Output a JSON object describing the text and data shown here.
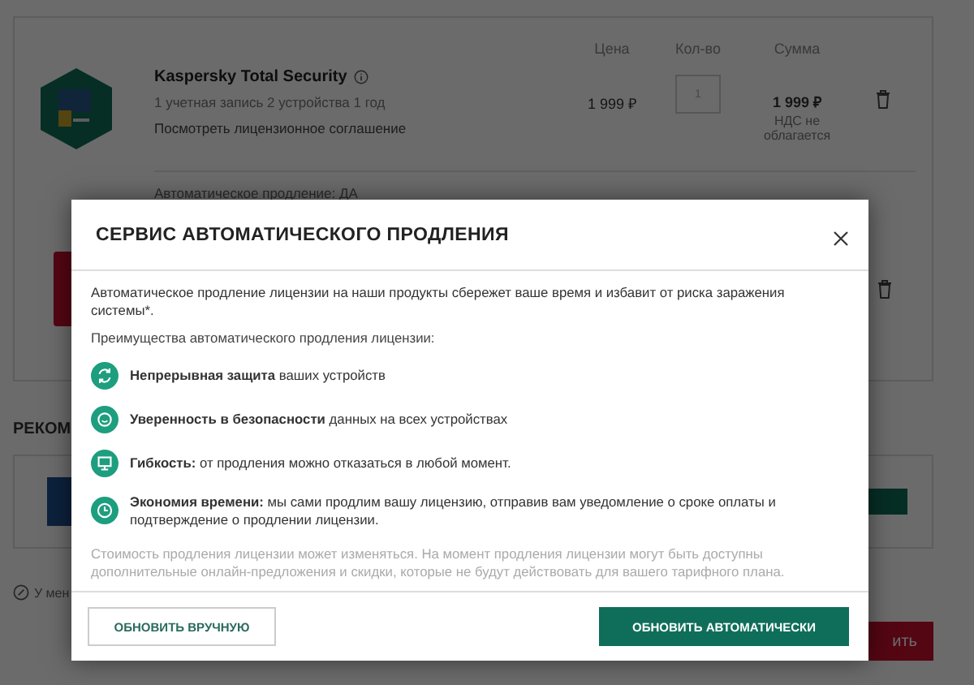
{
  "cart": {
    "columns": [
      "Цена",
      "Кол-во",
      "Сумма"
    ],
    "product": {
      "name": "Kaspersky Total Security",
      "details": "1 учетная запись 2 устройства 1 год",
      "agreement_link": "Посмотреть лицензионное соглашение",
      "price": "1 999 ₽",
      "quantity": "1",
      "total": "1 999 ₽",
      "vat_note": "НДС не облагается",
      "auto_renewal": "Автоматическое продление: ДА"
    }
  },
  "recommended": {
    "heading": "РЕКОМ"
  },
  "discount_note": "У мен",
  "checkout_button": "ить",
  "dialog": {
    "title": "СЕРВИС АВТОМАТИЧЕСКОГО ПРОДЛЕНИЯ",
    "intro": "Автоматическое продление лицензии на наши продукты сбережет ваше время и избавит от риска заражения системы*.",
    "benefits_heading": "Преимущества автоматического продления лицензии:",
    "benefits": [
      {
        "text": "**Непрерывная защита** ваших устройств"
      },
      {
        "text": "**Уверенность в безопасности** данных на всех устройствах"
      },
      {
        "text": "**Гибкость:** от продления можно отказаться в любой момент."
      },
      {
        "text": "**Экономия времени:** мы сами продлим вашу лицензию, отправив вам уведомление о сроке оплаты и подтверждение о продлении лицензии."
      }
    ],
    "disclaimer": "Стоимость продления лицензии может изменяться. На момент продления лицензии могут быть доступны дополнительные онлайн-предложения и скидки, которые не будут действовать для вашего тарифного плана.",
    "buttons": [
      {
        "label": "ОБНОВИТЬ ВРУЧНУЮ",
        "kind": "secondary"
      },
      {
        "label": "ОБНОВИТЬ АВТОМАТИЧЕСКИ",
        "kind": "primary"
      }
    ]
  }
}
